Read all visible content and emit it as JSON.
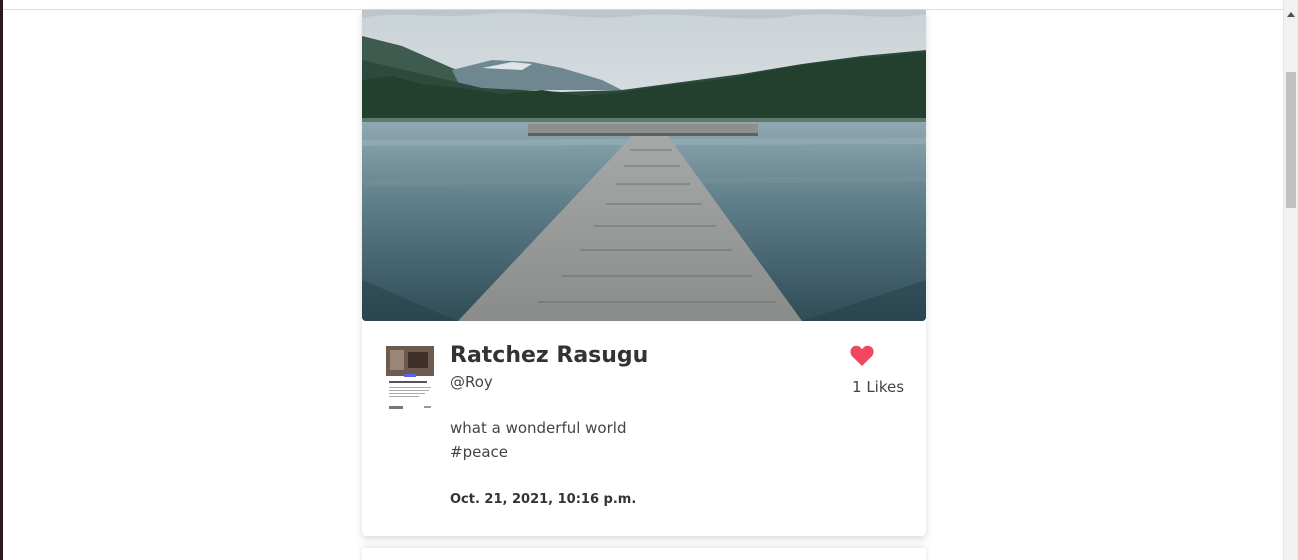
{
  "post": {
    "author_name": "Ratchez Rasugu",
    "username": "@Roy",
    "caption": "what a wonderful world",
    "hashtag": "#peace",
    "timestamp": "Oct. 21, 2021, 10:16 p.m.",
    "likes_count": "1",
    "likes_label": "Likes",
    "like_color": "#f0475e"
  },
  "icons": {
    "like": "heart-icon"
  }
}
